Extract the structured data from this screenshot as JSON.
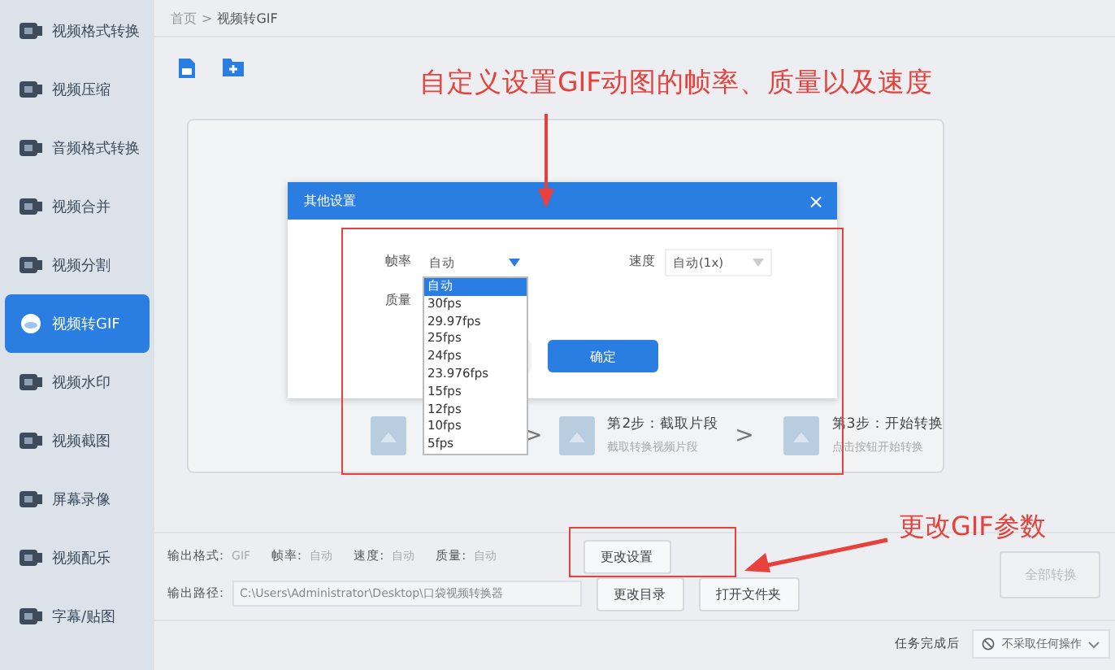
{
  "sidebar": {
    "items": [
      {
        "label": "视频格式转换",
        "selected": false
      },
      {
        "label": "视频压缩",
        "selected": false
      },
      {
        "label": "音频格式转换",
        "selected": false
      },
      {
        "label": "视频合并",
        "selected": false
      },
      {
        "label": "视频分割",
        "selected": false
      },
      {
        "label": "视频转GIF",
        "selected": true
      },
      {
        "label": "视频水印",
        "selected": false
      },
      {
        "label": "视频截图",
        "selected": false
      },
      {
        "label": "屏幕录像",
        "selected": false
      },
      {
        "label": "视频配乐",
        "selected": false
      },
      {
        "label": "字幕/贴图",
        "selected": false
      }
    ]
  },
  "breadcrumb": {
    "items": [
      "首页",
      "视频转GIF"
    ],
    "separator": ">"
  },
  "steps": [
    {
      "title": "第2步：截取片段",
      "subtitle": "截取转换视频片段"
    },
    {
      "title": "第3步：开始转换",
      "subtitle": "点击按钮开始转换"
    }
  ],
  "step_separator": ">",
  "dialog": {
    "title": "其他设置",
    "close": "×",
    "fields": [
      {
        "label": "帧率",
        "value": "自动",
        "open": true
      },
      {
        "label": "速度",
        "value": "自动(1x)",
        "open": false
      },
      {
        "label": "质量"
      }
    ],
    "dropdown": [
      {
        "label": "自动",
        "selected": true
      },
      {
        "label": "30fps",
        "selected": false
      },
      {
        "label": "29.97fps",
        "selected": false
      },
      {
        "label": "25fps",
        "selected": false
      },
      {
        "label": "24fps",
        "selected": false
      },
      {
        "label": "23.976fps",
        "selected": false
      },
      {
        "label": "15fps",
        "selected": false
      },
      {
        "label": "12fps",
        "selected": false
      },
      {
        "label": "10fps",
        "selected": false
      },
      {
        "label": "5fps",
        "selected": false
      }
    ],
    "buttons": [
      {
        "kind": "secondary"
      },
      {
        "kind": "primary",
        "label": "确定"
      }
    ]
  },
  "output": {
    "settings": [
      {
        "label": "输出格式:",
        "value": "GIF"
      },
      {
        "label": "帧率:",
        "value": "自动"
      },
      {
        "label": "速度:",
        "value": "自动"
      },
      {
        "label": "质量:",
        "value": "自动"
      }
    ],
    "settings_button": "更改设置",
    "path_label": "输出路径:",
    "path": "C:\\Users\\Administrator\\Desktop\\口袋视频转换器",
    "path_buttons": [
      "更改目录",
      "打开文件夹"
    ]
  },
  "convert_all": {
    "label": "全部转换",
    "disabled": true
  },
  "footer": {
    "label": "任务完成后",
    "select": "不采取任何操作"
  },
  "annotations": [
    {
      "kind": "top",
      "text": "自定义设置GIF动图的帧率、质量以及速度"
    },
    {
      "kind": "side",
      "text": "更改GIF参数"
    }
  ]
}
